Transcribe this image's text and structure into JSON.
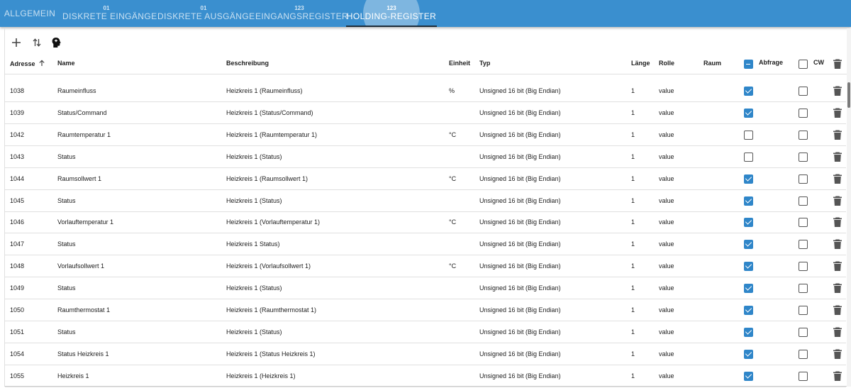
{
  "tabs": [
    {
      "sup": "",
      "label": "ALLGEMEIN"
    },
    {
      "sup": "01",
      "label": "DISKRETE EINGÄNGE"
    },
    {
      "sup": "01",
      "label": "DISKRETE AUSGÄNGE"
    },
    {
      "sup": "123",
      "label": "EINGANGSREGISTER"
    },
    {
      "sup": "123",
      "label": "HOLDING-REGISTER"
    }
  ],
  "active_tab": "HOLDING-REGISTER",
  "toolbar": {
    "add_icon": "plus-icon",
    "sort_icon": "swap-vertical-icon",
    "import_icon": "head-icon"
  },
  "columns": {
    "address": "Adresse",
    "name": "Name",
    "description": "Beschreibung",
    "unit": "Einheit",
    "type": "Typ",
    "length": "Länge",
    "role": "Rolle",
    "room": "Raum",
    "poll": "Abfrage",
    "cw": "CW"
  },
  "sort": {
    "column": "Adresse",
    "direction": "ascending"
  },
  "header_poll_checkbox": "indeterminate",
  "header_cw_checkbox": "unchecked",
  "colors": {
    "appbar": "#3a8fcf",
    "checkbox": "#2f86c9"
  },
  "rows": [
    {
      "address": "1038",
      "name": "Raumeinfluss",
      "description": "Heizkreis 1 (Raumeinfluss)",
      "unit": "%",
      "type": "Unsigned 16 bit (Big Endian)",
      "length": "1",
      "role": "value",
      "room": "",
      "poll": true,
      "cw": false
    },
    {
      "address": "1039",
      "name": "Status/Command",
      "description": "Heizkreis 1 (Status/Command)",
      "unit": "",
      "type": "Unsigned 16 bit (Big Endian)",
      "length": "1",
      "role": "value",
      "room": "",
      "poll": true,
      "cw": false
    },
    {
      "address": "1042",
      "name": "Raumtemperatur 1",
      "description": "Heizkreis 1 (Raumtemperatur 1)",
      "unit": "°C",
      "type": "Unsigned 16 bit (Big Endian)",
      "length": "1",
      "role": "value",
      "room": "",
      "poll": false,
      "cw": false
    },
    {
      "address": "1043",
      "name": "Status",
      "description": "Heizkreis 1 (Status)",
      "unit": "",
      "type": "Unsigned 16 bit (Big Endian)",
      "length": "1",
      "role": "value",
      "room": "",
      "poll": false,
      "cw": false
    },
    {
      "address": "1044",
      "name": "Raumsollwert 1",
      "description": "Heizkreis 1 (Raumsollwert 1)",
      "unit": "°C",
      "type": "Unsigned 16 bit (Big Endian)",
      "length": "1",
      "role": "value",
      "room": "",
      "poll": true,
      "cw": false
    },
    {
      "address": "1045",
      "name": "Status",
      "description": "Heizkreis 1 (Status)",
      "unit": "",
      "type": "Unsigned 16 bit (Big Endian)",
      "length": "1",
      "role": "value",
      "room": "",
      "poll": true,
      "cw": false
    },
    {
      "address": "1046",
      "name": "Vorlauftemperatur 1",
      "description": "Heizkreis 1 (Vorlauftemperatur 1)",
      "unit": "°C",
      "type": "Unsigned 16 bit (Big Endian)",
      "length": "1",
      "role": "value",
      "room": "",
      "poll": true,
      "cw": false
    },
    {
      "address": "1047",
      "name": "Status",
      "description": "Heizkreis 1 Status)",
      "unit": "",
      "type": "Unsigned 16 bit (Big Endian)",
      "length": "1",
      "role": "value",
      "room": "",
      "poll": true,
      "cw": false
    },
    {
      "address": "1048",
      "name": "Vorlaufsollwert 1",
      "description": "Heizkreis 1 (Vorlaufsollwert 1)",
      "unit": "°C",
      "type": "Unsigned 16 bit (Big Endian)",
      "length": "1",
      "role": "value",
      "room": "",
      "poll": true,
      "cw": false
    },
    {
      "address": "1049",
      "name": "Status",
      "description": "Heizkreis 1 (Status)",
      "unit": "",
      "type": "Unsigned 16 bit (Big Endian)",
      "length": "1",
      "role": "value",
      "room": "",
      "poll": true,
      "cw": false
    },
    {
      "address": "1050",
      "name": "Raumthermostat 1",
      "description": "Heizkreis 1 (Raumthermostat 1)",
      "unit": "",
      "type": "Unsigned 16 bit (Big Endian)",
      "length": "1",
      "role": "value",
      "room": "",
      "poll": true,
      "cw": false
    },
    {
      "address": "1051",
      "name": "Status",
      "description": "Heizkreis 1 (Status)",
      "unit": "",
      "type": "Unsigned 16 bit (Big Endian)",
      "length": "1",
      "role": "value",
      "room": "",
      "poll": true,
      "cw": false
    },
    {
      "address": "1054",
      "name": "Status Heizkreis 1",
      "description": "Heizkreis 1 (Status Heizkreis 1)",
      "unit": "",
      "type": "Unsigned 16 bit (Big Endian)",
      "length": "1",
      "role": "value",
      "room": "",
      "poll": true,
      "cw": false
    },
    {
      "address": "1055",
      "name": "Heizkreis 1",
      "description": "Heizkreis 1 (Heizkreis 1)",
      "unit": "",
      "type": "Unsigned 16 bit (Big Endian)",
      "length": "1",
      "role": "value",
      "room": "",
      "poll": true,
      "cw": false
    }
  ]
}
